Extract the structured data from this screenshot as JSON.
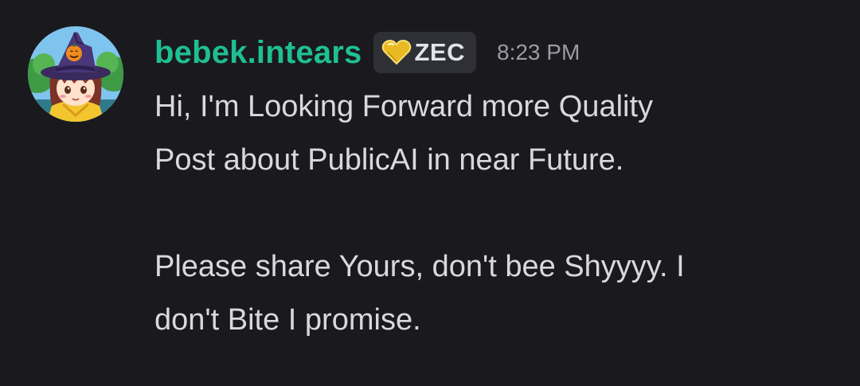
{
  "message": {
    "avatar_icon": "witch-girl-avatar",
    "username": "bebek.intears",
    "username_color": "#1fbf94",
    "tag": {
      "icon": "gold-heart-icon",
      "label": "ZEC"
    },
    "timestamp": "8:23 PM",
    "lines": [
      "Hi, I'm Looking Forward more Quality",
      "Post about PublicAI in near Future.",
      "Please share Yours, don't bee Shyyyy. I",
      "don't Bite I promise."
    ]
  },
  "colors": {
    "background": "#1a1a1e",
    "text": "#d8d9de",
    "timestamp": "#9a9ba3",
    "tag_background": "#2f3036"
  }
}
